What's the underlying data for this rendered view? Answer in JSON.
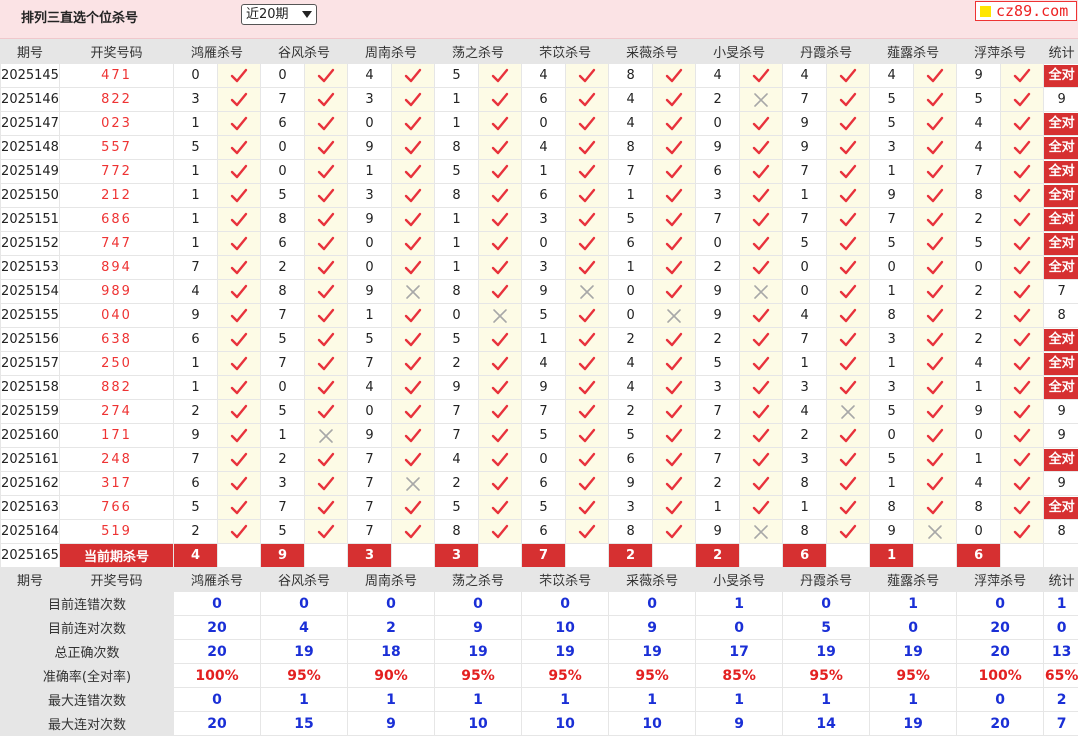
{
  "title": "排列三直选个位杀号",
  "select": {
    "value": "近20期"
  },
  "badge": {
    "text": "cz89.com"
  },
  "headers": {
    "period": "期号",
    "draw": "开奖号码",
    "experts": [
      "鸿雁杀号",
      "谷风杀号",
      "周南杀号",
      "荡之杀号",
      "芣苡杀号",
      "采薇杀号",
      "小旻杀号",
      "丹霞杀号",
      "薤露杀号",
      "浮萍杀号"
    ],
    "stats": "统计"
  },
  "rows": [
    {
      "period": "2025145",
      "draw": "471",
      "kills": [
        "0",
        "0",
        "4",
        "5",
        "4",
        "8",
        "4",
        "4",
        "4",
        "9"
      ],
      "ok": [
        true,
        true,
        true,
        true,
        true,
        true,
        true,
        true,
        true,
        true
      ],
      "stat": "全对"
    },
    {
      "period": "2025146",
      "draw": "822",
      "kills": [
        "3",
        "7",
        "3",
        "1",
        "6",
        "4",
        "2",
        "7",
        "5",
        "5"
      ],
      "ok": [
        true,
        true,
        true,
        true,
        true,
        true,
        false,
        true,
        true,
        true
      ],
      "stat": "9"
    },
    {
      "period": "2025147",
      "draw": "023",
      "kills": [
        "1",
        "6",
        "0",
        "1",
        "0",
        "4",
        "0",
        "9",
        "5",
        "4"
      ],
      "ok": [
        true,
        true,
        true,
        true,
        true,
        true,
        true,
        true,
        true,
        true
      ],
      "stat": "全对"
    },
    {
      "period": "2025148",
      "draw": "557",
      "kills": [
        "5",
        "0",
        "9",
        "8",
        "4",
        "8",
        "9",
        "9",
        "3",
        "4"
      ],
      "ok": [
        true,
        true,
        true,
        true,
        true,
        true,
        true,
        true,
        true,
        true
      ],
      "stat": "全对"
    },
    {
      "period": "2025149",
      "draw": "772",
      "kills": [
        "1",
        "0",
        "1",
        "5",
        "1",
        "7",
        "6",
        "7",
        "1",
        "7"
      ],
      "ok": [
        true,
        true,
        true,
        true,
        true,
        true,
        true,
        true,
        true,
        true
      ],
      "stat": "全对"
    },
    {
      "period": "2025150",
      "draw": "212",
      "kills": [
        "1",
        "5",
        "3",
        "8",
        "6",
        "1",
        "3",
        "1",
        "9",
        "8"
      ],
      "ok": [
        true,
        true,
        true,
        true,
        true,
        true,
        true,
        true,
        true,
        true
      ],
      "stat": "全对"
    },
    {
      "period": "2025151",
      "draw": "686",
      "kills": [
        "1",
        "8",
        "9",
        "1",
        "3",
        "5",
        "7",
        "7",
        "7",
        "2"
      ],
      "ok": [
        true,
        true,
        true,
        true,
        true,
        true,
        true,
        true,
        true,
        true
      ],
      "stat": "全对"
    },
    {
      "period": "2025152",
      "draw": "747",
      "kills": [
        "1",
        "6",
        "0",
        "1",
        "0",
        "6",
        "0",
        "5",
        "5",
        "5"
      ],
      "ok": [
        true,
        true,
        true,
        true,
        true,
        true,
        true,
        true,
        true,
        true
      ],
      "stat": "全对"
    },
    {
      "period": "2025153",
      "draw": "894",
      "kills": [
        "7",
        "2",
        "0",
        "1",
        "3",
        "1",
        "2",
        "0",
        "0",
        "0"
      ],
      "ok": [
        true,
        true,
        true,
        true,
        true,
        true,
        true,
        true,
        true,
        true
      ],
      "stat": "全对"
    },
    {
      "period": "2025154",
      "draw": "989",
      "kills": [
        "4",
        "8",
        "9",
        "8",
        "9",
        "0",
        "9",
        "0",
        "1",
        "2"
      ],
      "ok": [
        true,
        true,
        false,
        true,
        false,
        true,
        false,
        true,
        true,
        true
      ],
      "stat": "7"
    },
    {
      "period": "2025155",
      "draw": "040",
      "kills": [
        "9",
        "7",
        "1",
        "0",
        "5",
        "0",
        "9",
        "4",
        "8",
        "2"
      ],
      "ok": [
        true,
        true,
        true,
        false,
        true,
        false,
        true,
        true,
        true,
        true
      ],
      "stat": "8"
    },
    {
      "period": "2025156",
      "draw": "638",
      "kills": [
        "6",
        "5",
        "5",
        "5",
        "1",
        "2",
        "2",
        "7",
        "3",
        "2"
      ],
      "ok": [
        true,
        true,
        true,
        true,
        true,
        true,
        true,
        true,
        true,
        true
      ],
      "stat": "全对"
    },
    {
      "period": "2025157",
      "draw": "250",
      "kills": [
        "1",
        "7",
        "7",
        "2",
        "4",
        "4",
        "5",
        "1",
        "1",
        "4"
      ],
      "ok": [
        true,
        true,
        true,
        true,
        true,
        true,
        true,
        true,
        true,
        true
      ],
      "stat": "全对"
    },
    {
      "period": "2025158",
      "draw": "882",
      "kills": [
        "1",
        "0",
        "4",
        "9",
        "9",
        "4",
        "3",
        "3",
        "3",
        "1"
      ],
      "ok": [
        true,
        true,
        true,
        true,
        true,
        true,
        true,
        true,
        true,
        true
      ],
      "stat": "全对"
    },
    {
      "period": "2025159",
      "draw": "274",
      "kills": [
        "2",
        "5",
        "0",
        "7",
        "7",
        "2",
        "7",
        "4",
        "5",
        "9"
      ],
      "ok": [
        true,
        true,
        true,
        true,
        true,
        true,
        true,
        false,
        true,
        true
      ],
      "stat": "9"
    },
    {
      "period": "2025160",
      "draw": "171",
      "kills": [
        "9",
        "1",
        "9",
        "7",
        "5",
        "5",
        "2",
        "2",
        "0",
        "0"
      ],
      "ok": [
        true,
        false,
        true,
        true,
        true,
        true,
        true,
        true,
        true,
        true
      ],
      "stat": "9"
    },
    {
      "period": "2025161",
      "draw": "248",
      "kills": [
        "7",
        "2",
        "7",
        "4",
        "0",
        "6",
        "7",
        "3",
        "5",
        "1"
      ],
      "ok": [
        true,
        true,
        true,
        true,
        true,
        true,
        true,
        true,
        true,
        true
      ],
      "stat": "全对"
    },
    {
      "period": "2025162",
      "draw": "317",
      "kills": [
        "6",
        "3",
        "7",
        "2",
        "6",
        "9",
        "2",
        "8",
        "1",
        "4"
      ],
      "ok": [
        true,
        true,
        false,
        true,
        true,
        true,
        true,
        true,
        true,
        true
      ],
      "stat": "9"
    },
    {
      "period": "2025163",
      "draw": "766",
      "kills": [
        "5",
        "7",
        "7",
        "5",
        "5",
        "3",
        "1",
        "1",
        "8",
        "8"
      ],
      "ok": [
        true,
        true,
        true,
        true,
        true,
        true,
        true,
        true,
        true,
        true
      ],
      "stat": "全对"
    },
    {
      "period": "2025164",
      "draw": "519",
      "kills": [
        "2",
        "5",
        "7",
        "8",
        "6",
        "8",
        "9",
        "8",
        "9",
        "0"
      ],
      "ok": [
        true,
        true,
        true,
        true,
        true,
        true,
        false,
        true,
        false,
        true
      ],
      "stat": "8"
    }
  ],
  "current": {
    "period": "2025165",
    "label": "当前期杀号",
    "kills": [
      "4",
      "9",
      "3",
      "3",
      "7",
      "2",
      "2",
      "6",
      "1",
      "6"
    ]
  },
  "summary": [
    {
      "label": "目前连错次数",
      "values": [
        "0",
        "0",
        "0",
        "0",
        "0",
        "0",
        "1",
        "0",
        "1",
        "0"
      ],
      "stat": "1",
      "kind": "stat"
    },
    {
      "label": "目前连对次数",
      "values": [
        "20",
        "4",
        "2",
        "9",
        "10",
        "9",
        "0",
        "5",
        "0",
        "20"
      ],
      "stat": "0",
      "kind": "stat"
    },
    {
      "label": "总正确次数",
      "values": [
        "20",
        "19",
        "18",
        "19",
        "19",
        "19",
        "17",
        "19",
        "19",
        "20"
      ],
      "stat": "13",
      "kind": "stat"
    },
    {
      "label": "准确率(全对率)",
      "values": [
        "100%",
        "95%",
        "90%",
        "95%",
        "95%",
        "95%",
        "85%",
        "95%",
        "95%",
        "100%"
      ],
      "stat": "65%",
      "kind": "rate"
    },
    {
      "label": "最大连错次数",
      "values": [
        "0",
        "1",
        "1",
        "1",
        "1",
        "1",
        "1",
        "1",
        "1",
        "0"
      ],
      "stat": "2",
      "kind": "stat"
    },
    {
      "label": "最大连对次数",
      "values": [
        "20",
        "15",
        "9",
        "10",
        "10",
        "10",
        "9",
        "14",
        "19",
        "20"
      ],
      "stat": "7",
      "kind": "stat"
    }
  ],
  "colors": {
    "accent": "#d63031",
    "check": "#e8323c",
    "cross": "#a8a8a8",
    "stat_blue": "#1a2fd6",
    "header_bg": "#e6e6e6",
    "mark_bg": "#fdfbe6"
  },
  "icons": {
    "ok": "check-icon",
    "wrong": "cross-icon"
  }
}
